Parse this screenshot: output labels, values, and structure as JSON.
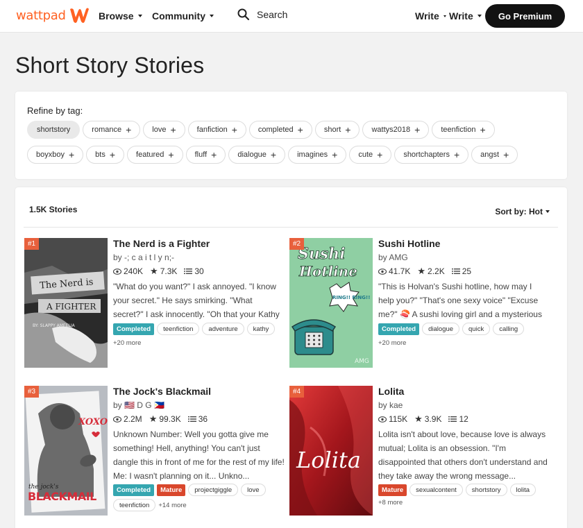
{
  "header": {
    "logo_text": "wattpad",
    "nav": {
      "browse": "Browse",
      "community": "Community"
    },
    "search_label": "Search",
    "write_1": "Write",
    "write_2": "Write",
    "premium": "Go Premium",
    "brand_color": "#ff6122"
  },
  "page": {
    "title": "Short Story Stories"
  },
  "refine": {
    "label": "Refine by tag:",
    "row1": [
      "shortstory",
      "romance",
      "love",
      "fanfiction",
      "completed",
      "short",
      "wattys2018",
      "teenfiction"
    ],
    "row2": [
      "boyxboy",
      "bts",
      "featured",
      "fluff",
      "dialogue",
      "imagines",
      "cute",
      "shortchapters",
      "angst"
    ]
  },
  "list": {
    "count": "1.5K Stories",
    "sort": "Sort by: Hot"
  },
  "stories": [
    {
      "rank": "#1",
      "title": "The Nerd is a Fighter",
      "author": "by -; c a i t l y n;-",
      "reads": "240K",
      "votes": "7.3K",
      "parts": "30",
      "desc": "\"What do you want?\" I ask annoyed. \"I know your secret.\" He says smirking. \"What secret?\" I ask innocently. \"Oh that your Kathy Mil...",
      "cover_text_1": "The Nerd is",
      "cover_text_2": "A FIGHTER",
      "cover_text_3": "BY: SLAPPY AMEELIA",
      "completed": "Completed",
      "tags": [
        "teenfiction",
        "adventure",
        "kathy"
      ],
      "more": "+20 more"
    },
    {
      "rank": "#2",
      "title": "Sushi Hotline",
      "author": "by AMG",
      "reads": "41.7K",
      "votes": "2.2K",
      "parts": "25",
      "desc": "\"This is Holvan's Sushi hotline, how may I help you?\" \"That's one sexy voice\" \"Excuse me?\" 🍣 A sushi loving girl and a mysterious hotline...",
      "cover_text_1": "Sushi",
      "cover_text_2": "Hotline",
      "cover_text_3": "RING!! RING!!",
      "cover_text_4": "AMG",
      "completed": "Completed",
      "tags": [
        "dialogue",
        "quick",
        "calling"
      ],
      "more": "+20 more"
    },
    {
      "rank": "#3",
      "title": "The Jock's Blackmail",
      "author": "by 🇺🇸 D G 🇵🇭",
      "reads": "2.2M",
      "votes": "99.3K",
      "parts": "36",
      "desc": "Unknown Number: Well you gotta give me something! Hell, anything! You can't just dangle this in front of me for the rest of my life! Me: I wasn't planning on it... Unkno...",
      "cover_text_1": "XOXO",
      "cover_text_2": "the jock's",
      "cover_text_3": "BLACKMAIL",
      "completed": "Completed",
      "mature": "Mature",
      "tags": [
        "projectgiggle",
        "love",
        "teenfiction"
      ],
      "more": "+14 more"
    },
    {
      "rank": "#4",
      "title": "Lolita",
      "author": "by kae",
      "reads": "115K",
      "votes": "3.9K",
      "parts": "12",
      "desc": "Lolita isn't about love, because love is always mutual; Lolita is an obsession. \"I'm disappointed that others don't understand and they take away the wrong message...",
      "cover_text_1": "Lolita",
      "mature": "Mature",
      "tags": [
        "sexualcontent",
        "shortstory",
        "lolita"
      ],
      "more": "+8 more"
    }
  ]
}
